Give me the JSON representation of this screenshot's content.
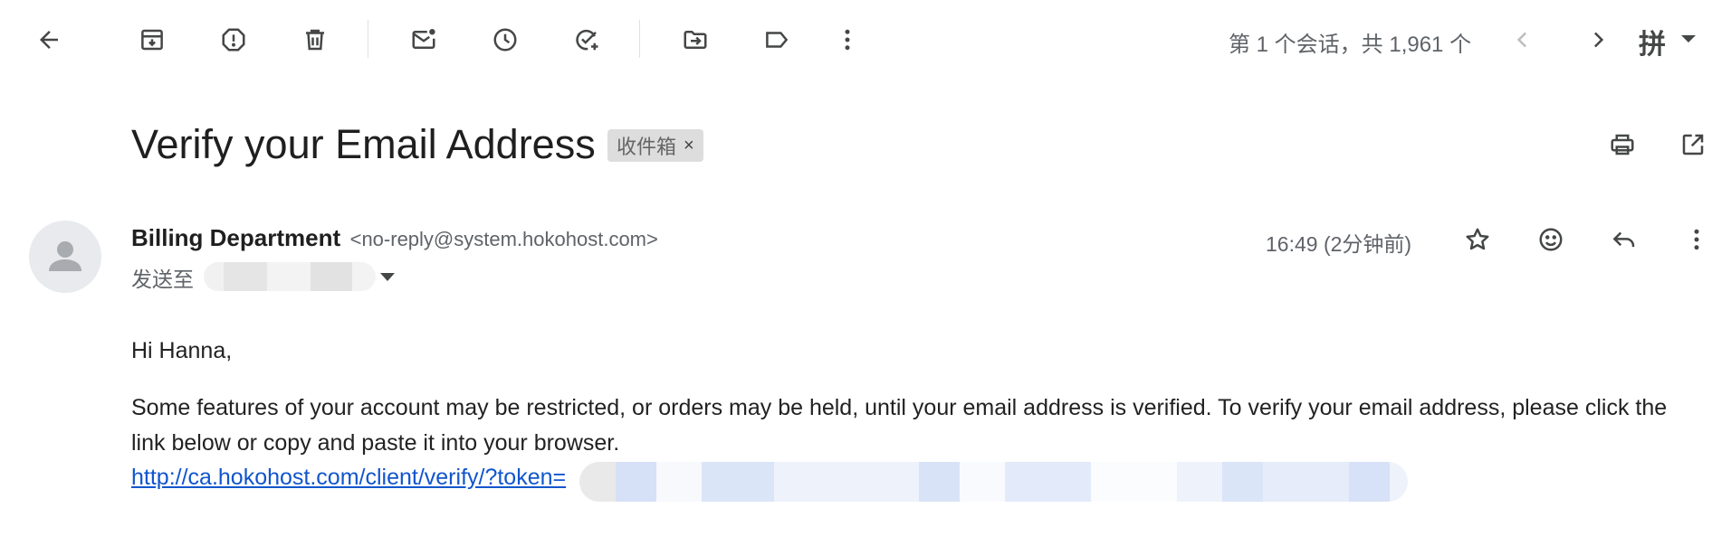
{
  "toolbar": {
    "icons": [
      "back-arrow-icon",
      "archive-icon",
      "report-spam-icon",
      "delete-icon",
      "mark-unread-icon",
      "snooze-icon",
      "add-to-tasks-icon",
      "move-to-icon",
      "label-icon",
      "more-vert-icon"
    ],
    "conversation_count": "第 1 个会话，共 1,961 个",
    "ime_label": "拼"
  },
  "header": {
    "subject": "Verify your Email Address",
    "label_tag": "收件箱",
    "label_remove": "×"
  },
  "message": {
    "sender_name": "Billing Department",
    "sender_email": "<no-reply@system.hokohost.com>",
    "to_prefix": "发送至",
    "timestamp": "16:49 (2分钟前)",
    "greeting": "Hi Hanna,",
    "paragraph": "Some features of your account may be restricted, or orders may be held, until your email address is verified. To verify your email address, please click the link below or copy and paste it into your browser.",
    "link_text": "http://ca.hokohost.com/client/verify/?token="
  },
  "colors": {
    "link": "#1155cc",
    "icon": "#444746",
    "muted_text": "#5f6368",
    "tag_bg": "#dddddd"
  }
}
